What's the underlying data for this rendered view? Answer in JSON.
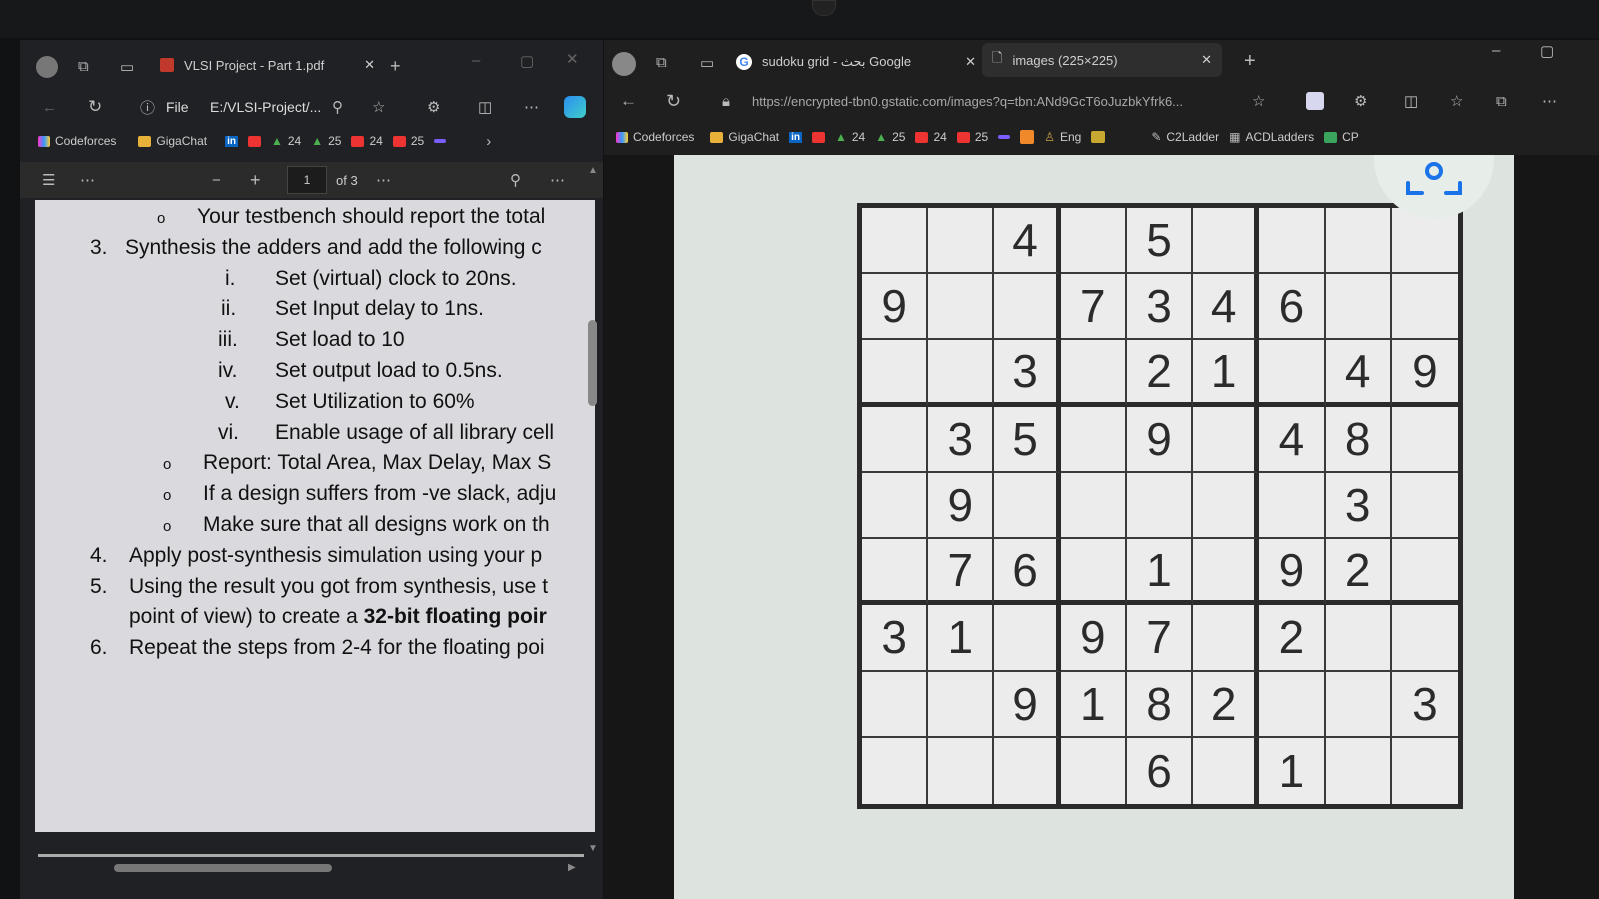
{
  "left": {
    "tab_title": "VLSI Project - Part 1.pdf",
    "address_prefix": "File",
    "address": "E:/VLSI-Project/...",
    "bookmarks": [
      "Codeforces",
      "GigaChat",
      "24",
      "25",
      "24",
      "25"
    ],
    "pdf": {
      "page_value": "1",
      "page_total": "of 3",
      "lines": [
        {
          "bullet": "o",
          "text": "Your testbench should report the total"
        },
        {
          "bullet": "3.",
          "text": "Synthesis the adders and add the following c"
        },
        {
          "bullet": "i.",
          "text": "Set (virtual) clock to 20ns."
        },
        {
          "bullet": "ii.",
          "text": "Set Input delay to 1ns."
        },
        {
          "bullet": "iii.",
          "text": "Set load to 10"
        },
        {
          "bullet": "iv.",
          "text": "Set output load to 0.5ns."
        },
        {
          "bullet": "v.",
          "text": "Set Utilization to 60%"
        },
        {
          "bullet": "vi.",
          "text": "Enable usage of all library cell"
        },
        {
          "bullet": "o",
          "text": "Report: Total Area, Max Delay, Max S"
        },
        {
          "bullet": "o",
          "text": "If a design suffers from -ve slack, adju"
        },
        {
          "bullet": "o",
          "text": "Make sure that all designs work on th"
        },
        {
          "bullet": "4.",
          "text": "Apply post-synthesis simulation using your p"
        },
        {
          "bullet": "5.",
          "text": "Using the result you got from synthesis, use t"
        },
        {
          "bullet": "",
          "text": "point of view) to create a ",
          "bold": "32-bit floating poir"
        },
        {
          "bullet": "6.",
          "text": "Repeat the steps from 2-4 for the floating poi"
        }
      ]
    }
  },
  "right": {
    "tab1_title": "sudoku grid - بحث Google",
    "tab2_title": "images (225×225)",
    "url": "https://encrypted-tbn0.gstatic.com/images?q=tbn:ANd9GcT6oJuzbkYfrk6...",
    "bookmarks": [
      "Codeforces",
      "GigaChat",
      "24",
      "25",
      "24",
      "25",
      "Eng",
      "C2Ladder",
      "ACDLadders",
      "CP"
    ],
    "sudoku": [
      [
        "",
        "",
        "4",
        "",
        "5",
        "",
        "",
        "",
        ""
      ],
      [
        "9",
        "",
        "",
        "7",
        "3",
        "4",
        "6",
        "",
        ""
      ],
      [
        "",
        "",
        "3",
        "",
        "2",
        "1",
        "",
        "4",
        "9"
      ],
      [
        "",
        "3",
        "5",
        "",
        "9",
        "",
        "4",
        "8",
        ""
      ],
      [
        "",
        "9",
        "",
        "",
        "",
        "",
        "",
        "3",
        ""
      ],
      [
        "",
        "7",
        "6",
        "",
        "1",
        "",
        "9",
        "2",
        ""
      ],
      [
        "3",
        "1",
        "",
        "9",
        "7",
        "",
        "2",
        "",
        ""
      ],
      [
        "",
        "",
        "9",
        "1",
        "8",
        "2",
        "",
        "",
        "3"
      ],
      [
        "",
        "",
        "",
        "",
        "6",
        "",
        "1",
        "",
        ""
      ]
    ]
  },
  "colors": {
    "accent_youtube": "#e33",
    "folder": "#e8b23a",
    "linkedin": "#0a66c2"
  }
}
